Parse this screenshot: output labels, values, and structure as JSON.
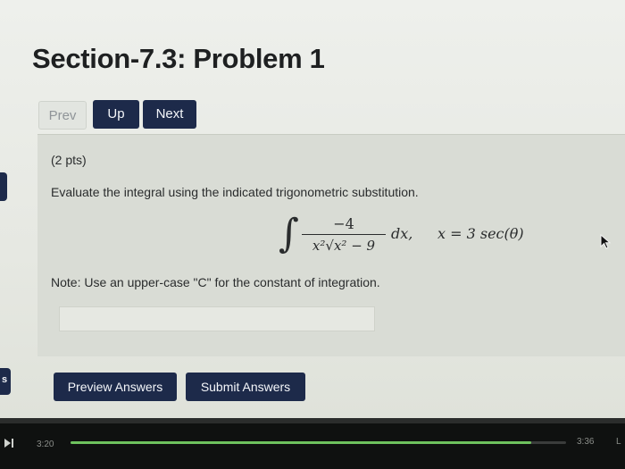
{
  "page": {
    "title": "Section-7.3: Problem 1"
  },
  "nav": {
    "prev_label": "Prev",
    "up_label": "Up",
    "next_label": "Next"
  },
  "problem": {
    "points": "(2 pts)",
    "statement": "Evaluate the integral using the indicated trigonometric substitution.",
    "formula": {
      "numerator": "−4",
      "denominator": "x²√x² − 9",
      "differential": "dx,",
      "substitution": "x = 3 sec(θ)"
    },
    "note": "Note: Use an upper-case \"C\" for the constant of integration.",
    "answer_value": ""
  },
  "actions": {
    "preview_label": "Preview Answers",
    "submit_label": "Submit Answers"
  },
  "side_tab_label": "s",
  "player": {
    "time_elapsed": "3:20",
    "time_total": "3:36",
    "corner_label": "L",
    "progress": 0.93
  },
  "colors": {
    "accent": "#1d2a4a",
    "progress": "#6ec25e"
  }
}
